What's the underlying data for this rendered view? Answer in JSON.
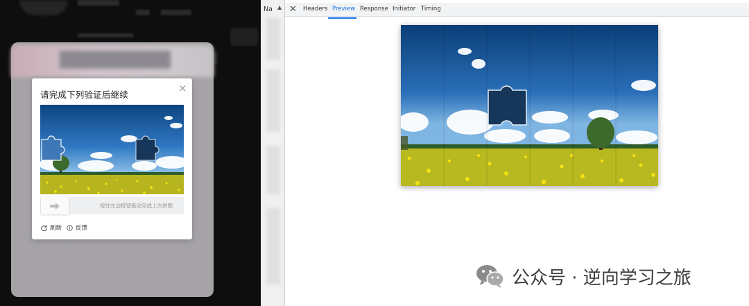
{
  "captcha": {
    "title": "请完成下列验证后继续",
    "close_glyph": "×",
    "slider_hint": "按住左边按钮拖动完成上方拼图",
    "refresh_label": "刷新",
    "feedback_label": "反馈"
  },
  "network_list": {
    "column_header": "Na",
    "sort_glyph": "▲"
  },
  "devtools": {
    "close_glyph": "✕",
    "tabs": [
      "Headers",
      "Preview",
      "Response",
      "Initiator",
      "Timing"
    ],
    "active_tab": "Preview"
  },
  "watermark": {
    "text": "公众号 · 逆向学习之旅",
    "icon": "wechat-icon"
  },
  "colors": {
    "accent": "#1a73e8",
    "sky_top": "#0f4a8a",
    "grass": "#c9c41e"
  }
}
